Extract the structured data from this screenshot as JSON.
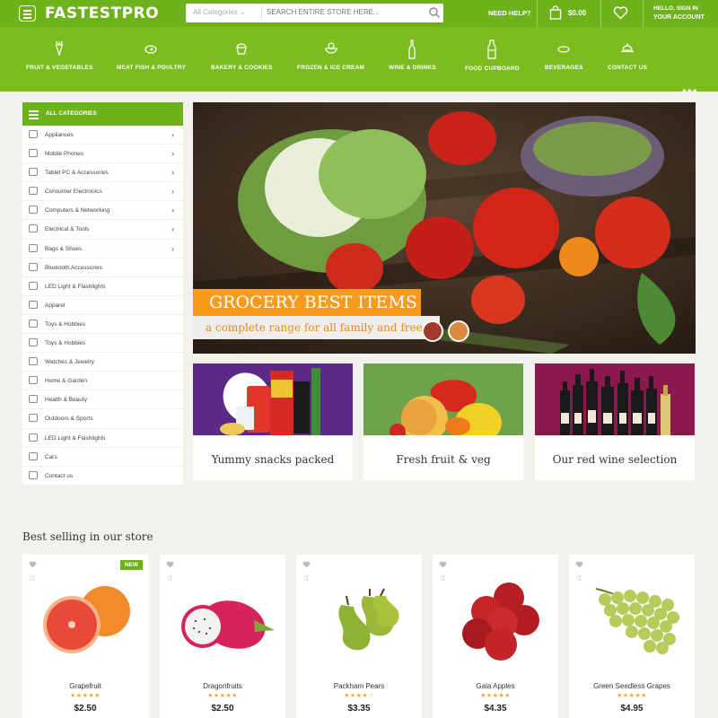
{
  "header": {
    "logo": "FASTESTPRO",
    "search_category": "All Categories",
    "search_placeholder": "SEARCH ENTIRE STORE HERE...",
    "need_help": "NEED HELP?",
    "cart_total": "$0.00",
    "account_line1": "HELLO, SIGN IN",
    "account_line2": "YOUR ACCOUNT"
  },
  "nav": {
    "items": [
      {
        "label": "FRUIT & VEGETABLES",
        "icon": "carrot-icon"
      },
      {
        "label": "MEAT FISH & POULTRY",
        "icon": "steak-icon"
      },
      {
        "label": "BAKERY & COOKIES",
        "icon": "cupcake-icon"
      },
      {
        "label": "FROZEN & ICE CREAM",
        "icon": "ice-cream-icon"
      },
      {
        "label": "WINE & DRINKS",
        "icon": "bottle-icon"
      },
      {
        "label": "FOOD CUPBOARD",
        "icon": "jar-icon"
      },
      {
        "label": "BEVERAGES",
        "icon": "cup-icon"
      },
      {
        "label": "CONTACT US",
        "icon": "tray-icon"
      }
    ],
    "more": "•••"
  },
  "sidebar": {
    "title": "ALL CATEGORIES",
    "items": [
      {
        "label": "Appliances",
        "arrow": true
      },
      {
        "label": "Mobile Phones",
        "arrow": true
      },
      {
        "label": "Tablet PC & Accessories",
        "arrow": true
      },
      {
        "label": "Consumer Electronics",
        "arrow": true
      },
      {
        "label": "Computers & Networking",
        "arrow": true
      },
      {
        "label": "Electrical & Tools",
        "arrow": true
      },
      {
        "label": "Bags & Shoes",
        "arrow": true
      },
      {
        "label": "Bluetooth Accessories",
        "arrow": false
      },
      {
        "label": "LED Light & Flashlights",
        "arrow": false
      },
      {
        "label": "Apparel",
        "arrow": false
      },
      {
        "label": "Toys & Hobbies",
        "arrow": false
      },
      {
        "label": "Toys & Hobbies",
        "arrow": false
      },
      {
        "label": "Watches & Jewelry",
        "arrow": false
      },
      {
        "label": "Home & Garden",
        "arrow": false
      },
      {
        "label": "Health & Beauty",
        "arrow": false
      },
      {
        "label": "Outdoors & Sports",
        "arrow": false
      },
      {
        "label": "LED Light & Flashlights",
        "arrow": false
      },
      {
        "label": "Cars",
        "arrow": false
      },
      {
        "label": "Contact us",
        "arrow": false
      }
    ]
  },
  "hero": {
    "title": "GROCERY BEST ITEMS",
    "subtitle": "a complete range for all family and free deliv"
  },
  "promos": [
    {
      "caption": "Yummy snacks packed",
      "color": "#5b2a86"
    },
    {
      "caption": "Fresh fruit & veg",
      "color": "#6fa34a"
    },
    {
      "caption": "Our red wine selection",
      "color": "#8a1a4e"
    }
  ],
  "best_selling": {
    "title": "Best selling in our store",
    "products": [
      {
        "name": "Grapefruit",
        "price": "$2.50",
        "stars": "★★★★★",
        "badge": "NEW"
      },
      {
        "name": "Dragonfruits",
        "price": "$2.50",
        "stars": "★★★★★",
        "badge": ""
      },
      {
        "name": "Packham Pears",
        "price": "$3.35",
        "stars": "★★★★☆",
        "badge": ""
      },
      {
        "name": "Gala Apples",
        "price": "$4.35",
        "stars": "★★★★★",
        "badge": ""
      },
      {
        "name": "Green Seedless Grapes",
        "price": "$4.95",
        "stars": "★★★★★",
        "badge": ""
      }
    ]
  },
  "colors": {
    "brand_green": "#6db21a",
    "nav_green": "#7cbc1f",
    "accent_orange": "#f89a1c",
    "star": "#f5a623"
  }
}
